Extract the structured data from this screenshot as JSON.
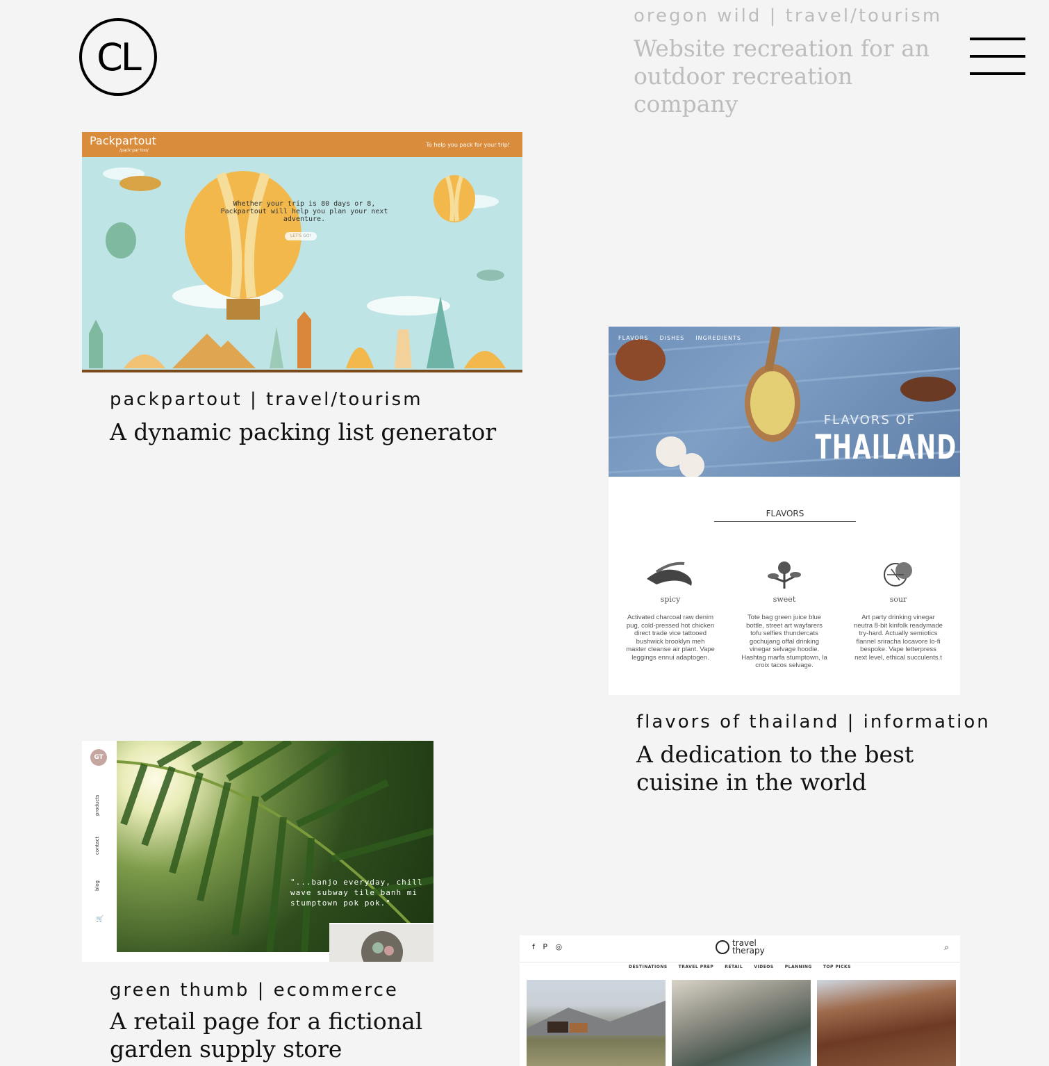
{
  "logo": {
    "text": "CL"
  },
  "projects": [
    {
      "tag": "oregon wild  |  travel/tourism",
      "desc": "Website recreation for an outdoor recreation company"
    },
    {
      "tag": "packpartout  |  travel/tourism",
      "desc": "A dynamic packing list generator",
      "preview": {
        "brand": "Packpartout",
        "brand_sub": "/pack·par·too/",
        "tagline": "To help you pack for your trip!",
        "hero": "Whether your trip is 80 days or 8, Packpartout will help you plan your next adventure.",
        "cta": "LET'S GO!"
      }
    },
    {
      "tag": "flavors of thailand  |  information",
      "desc": "A dedication to the best cuisine in the world",
      "preview": {
        "nav": [
          "FLAVORS",
          "DISHES",
          "INGREDIENTS"
        ],
        "title_small": "FLAVORS OF",
        "title_big": "THAILAND",
        "section": "FLAVORS",
        "columns": [
          {
            "name": "spicy",
            "text": "Activated charcoal raw denim pug, cold-pressed hot chicken direct trade vice tattooed bushwick brooklyn meh master cleanse air plant. Vape leggings ennui adaptogen."
          },
          {
            "name": "sweet",
            "text": "Tote bag green juice blue bottle, street art wayfarers tofu selfies thundercats gochujang offal drinking vinegar selvage hoodie. Hashtag marfa stumptown, la croix tacos selvage."
          },
          {
            "name": "sour",
            "text": "Art party drinking vinegar neutra 8-bit kinfolk readymade try-hard. Actually semiotics flannel sriracha locavore lo-fi bespoke. Vape letterpress next level, ethical succulents.t"
          }
        ]
      }
    },
    {
      "tag": "green thumb  |  ecommerce",
      "desc": "A retail page for a fictional garden supply store",
      "preview": {
        "badge": "GT",
        "side_links": [
          "products",
          "contact",
          "blog"
        ],
        "quote": "\"...banjo everyday, chill wave subway tile banh mi stumptown pok pok.\""
      }
    },
    {
      "preview": {
        "social": "f  P  ◎",
        "logo_line1": "travel",
        "logo_line2": "therapy",
        "nav": [
          "DESTINATIONS",
          "TRAVEL PREP",
          "RETAIL",
          "VIDEOS",
          "PLANNING",
          "TOP PICKS"
        ]
      }
    }
  ]
}
